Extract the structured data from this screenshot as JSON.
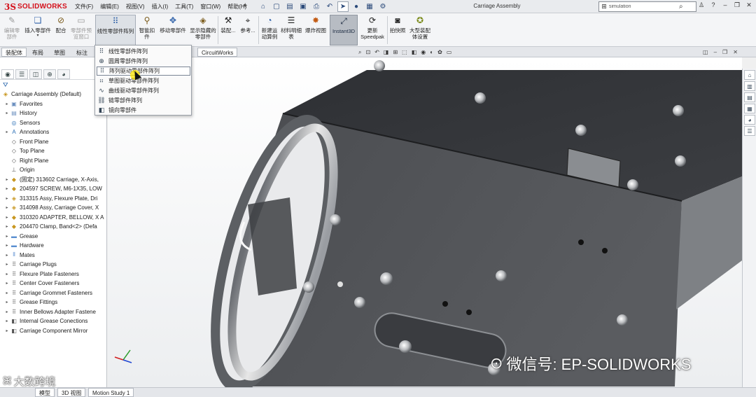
{
  "app": {
    "logo_mark": "3S",
    "logo_text": "SOLIDWORKS",
    "document_title": "Carriage Assembly",
    "menus": [
      "文件(F)",
      "编辑(E)",
      "视图(V)",
      "插入(I)",
      "工具(T)",
      "窗口(W)",
      "帮助(H)"
    ],
    "search_placeholder": "simulation",
    "help_label": "?"
  },
  "commands": {
    "edit_component": "编辑零部件",
    "insert_components": "插入零部件",
    "mate": "配合",
    "component_preview": "零部件预览窗口",
    "linear_pattern": "线性零部件阵列",
    "smart_fasteners": "智能扣件",
    "move_component": "移动零部件",
    "show_hidden": "显示隐藏的零部件",
    "assembly_features": "装配...",
    "reference_geometry": "参考...",
    "new_motion_study": "新建运动算例",
    "bill_of_materials": "材料明细表",
    "exploded_view": "爆炸视图",
    "instant3d": "Instant3D",
    "update_speedpak": "更新Speedpak",
    "take_snapshot": "拍快照",
    "large_assembly": "大型装配体设置"
  },
  "tabs": [
    "装配体",
    "布局",
    "草图",
    "标注",
    "CircuitWorks"
  ],
  "flyout": [
    {
      "icon": "linear-pattern-icon",
      "label": "线性零部件阵列"
    },
    {
      "icon": "circular-pattern-icon",
      "label": "圆周零部件阵列"
    },
    {
      "icon": "pattern-driven-icon",
      "label": "阵列驱动零部件阵列"
    },
    {
      "icon": "sketch-driven-icon",
      "label": "草图驱动零部件阵列"
    },
    {
      "icon": "curve-driven-icon",
      "label": "曲线驱动零部件阵列"
    },
    {
      "icon": "chain-pattern-icon",
      "label": "链零部件阵列"
    },
    {
      "icon": "mirror-icon",
      "label": "镜向零部件"
    }
  ],
  "tree": {
    "root": "Carriage Assembly  (Default)",
    "items": [
      {
        "label": "Favorites",
        "icon": "folder-star-icon"
      },
      {
        "label": "History",
        "icon": "history-icon"
      },
      {
        "label": "Sensors",
        "icon": "sensor-icon"
      },
      {
        "label": "Annotations",
        "icon": "annotations-icon"
      },
      {
        "label": "Front Plane",
        "icon": "plane-icon"
      },
      {
        "label": "Top Plane",
        "icon": "plane-icon"
      },
      {
        "label": "Right Plane",
        "icon": "plane-icon"
      },
      {
        "label": "Origin",
        "icon": "origin-icon"
      },
      {
        "label": "(固定) 313602 Carriage, X-Axis,",
        "icon": "part-icon"
      },
      {
        "label": "204597 SCREW, M6-1X35, LOW",
        "icon": "part-icon"
      },
      {
        "label": "313315 Assy, Flexure Plate, Dri",
        "icon": "assembly-icon"
      },
      {
        "label": "314098 Assy, Carriage Cover, X",
        "icon": "assembly-icon"
      },
      {
        "label": "310320 ADAPTER, BELLOW, X A",
        "icon": "part-icon"
      },
      {
        "label": "204470 Clamp, Band<2> (Defa",
        "icon": "part-icon"
      },
      {
        "label": "Grease",
        "icon": "folder-icon"
      },
      {
        "label": "Hardware",
        "icon": "folder-icon"
      },
      {
        "label": "Mates",
        "icon": "mates-icon"
      },
      {
        "label": "Carriage Plugs",
        "icon": "pattern-icon"
      },
      {
        "label": "Flexure Plate Fasteners",
        "icon": "pattern-icon"
      },
      {
        "label": "Center Cover Fasteners",
        "icon": "pattern-icon"
      },
      {
        "label": "Carriage Grommet Fasteners",
        "icon": "pattern-icon"
      },
      {
        "label": "Grease Fittings",
        "icon": "pattern-icon"
      },
      {
        "label": "Inner Bellows Adapter Fastene",
        "icon": "pattern-icon"
      },
      {
        "label": "Internal Grease Conections",
        "icon": "mirror-icon"
      },
      {
        "label": "Carriage Component Mirror",
        "icon": "mirror-icon"
      }
    ]
  },
  "status_tabs": [
    "模型",
    "3D 视图",
    "Motion Study 1"
  ],
  "watermark": {
    "left_text": "大数跨境",
    "right_text": "微信号: EP-SOLIDWORKS"
  },
  "colors": {
    "brand_red": "#d4111b",
    "body_dark": "#4a4c50",
    "ring_metal": "#c9c9c9"
  }
}
